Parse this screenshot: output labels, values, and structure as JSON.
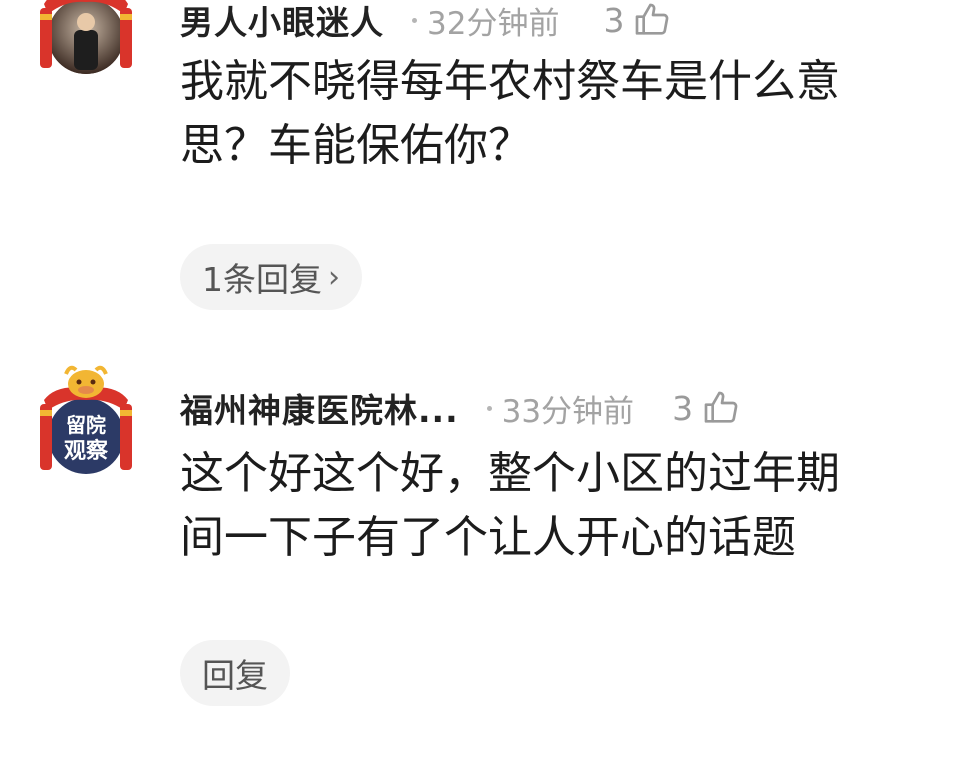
{
  "comments": [
    {
      "username": "男人小眼迷人",
      "time": "32分钟前",
      "likes": "3",
      "text_lines": [
        "我就不晓得每年农村祭车是什么意",
        "思？车能保佑你？"
      ],
      "reply_label": "1条回复",
      "avatar_icon": "festive-frame-avatar-icon"
    },
    {
      "username": "福州神康医院林...",
      "time": "33分钟前",
      "likes": "3",
      "text_lines": [
        "这个好这个好，整个小区的过年期",
        "间一下子有了个让人开心的话题"
      ],
      "reply_label": "回复",
      "avatar_icon": "festive-frame-avatar-icon",
      "avatar_text": [
        "留院",
        "观察"
      ]
    }
  ],
  "colors": {
    "text": "#1c1c1c",
    "meta": "#a3a3a3",
    "pill_bg": "#f3f3f3",
    "frame_red": "#d9342b",
    "frame_gold": "#f2b633"
  }
}
